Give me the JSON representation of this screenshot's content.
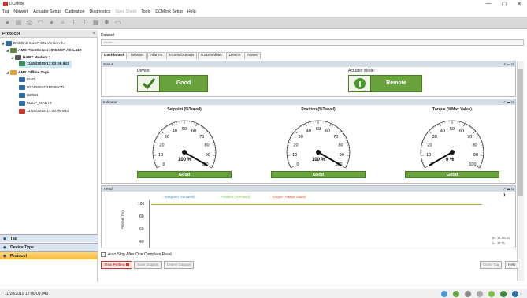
{
  "window": {
    "title": "DCMlink",
    "min": "—",
    "max": "▢",
    "close": "✕"
  },
  "menu": [
    "Tag",
    "Network",
    "Actuator Setup",
    "Calibration",
    "Diagnostics",
    "Spec Sheet",
    "Tools",
    "DCMlink Setup",
    "Help"
  ],
  "left": {
    "header": "Protocol",
    "close": "×",
    "tree": [
      {
        "label": "DCMlink SNAP-ON Version 2.4"
      },
      {
        "label": "AMS PlantServer: INESCP-AS-L412",
        "bold": true
      },
      {
        "label": "HART Modem 1",
        "bold": true
      },
      {
        "label": "11/28/2019 17:00:09.943",
        "bold": true,
        "selected": true
      },
      {
        "label": "AMS Offline Tags",
        "bold": true
      },
      {
        "label": "EHO"
      },
      {
        "label": "07743681D2FF8MOD"
      },
      {
        "label": "I50001"
      },
      {
        "label": "M2CP_HART2"
      },
      {
        "label": "11/28/2019 17:00:09.943"
      }
    ],
    "nav": [
      {
        "label": "Tag",
        "active": false
      },
      {
        "label": "Device Type",
        "active": false
      },
      {
        "label": "Protocol",
        "active": true
      }
    ]
  },
  "dataset": {
    "label": "Dataset",
    "value": "<none>"
  },
  "tabs": [
    "Dashboard",
    "Monitor",
    "Alarms",
    "Inputs/Outputs",
    "ESD/Inhibits",
    "Device",
    "Notes"
  ],
  "status": {
    "header": "Status",
    "ctrls": "↗ ▬ ◘",
    "device_label": "Device:",
    "device_value": "Good",
    "mode_label": "Actuator Mode:",
    "mode_value": "Remote"
  },
  "indicator": {
    "header": "Indicator",
    "ctrls": "↗ ▬ ◘",
    "gauges": [
      {
        "title": "Setpoint (%Travel)",
        "value": 100,
        "readout": "100 %",
        "status": "Good"
      },
      {
        "title": "Position (%Travel)",
        "value": 100,
        "readout": "100 %",
        "status": "Good"
      },
      {
        "title": "Torque (%Max Value)",
        "value": 0,
        "readout": "0 %",
        "status": "Good"
      }
    ],
    "ticks": [
      "0",
      "10",
      "20",
      "30",
      "40",
      "50",
      "60",
      "70",
      "80",
      "90",
      "100"
    ]
  },
  "trend": {
    "header": "Trend",
    "ctrls": "↗ ▬ ◘",
    "legend": [
      "- Setpoint (%Travel)",
      "- Position (%Travel)",
      "- Torque (%Max Value)"
    ],
    "legend_colors": [
      "#2b8fd6",
      "#7fbf3f",
      "#e05030"
    ],
    "ylabel": "Percent (%)",
    "yticks": [
      "100",
      "80",
      "60",
      "40"
    ],
    "time1": "14:10:41",
    "time2": "16:11",
    "time_prefix1": "a=",
    "time_prefix2": "u="
  },
  "bottom": {
    "auto_stop": "Auto Stop After One Complete Read",
    "stop_polling": "Stop Polling",
    "save": "Save Dataset",
    "delete": "Delete Dataset",
    "close_tag": "Close Tag",
    "help": "Help"
  },
  "statusbar": {
    "text": "11/28/2019 17:00:09.943"
  }
}
